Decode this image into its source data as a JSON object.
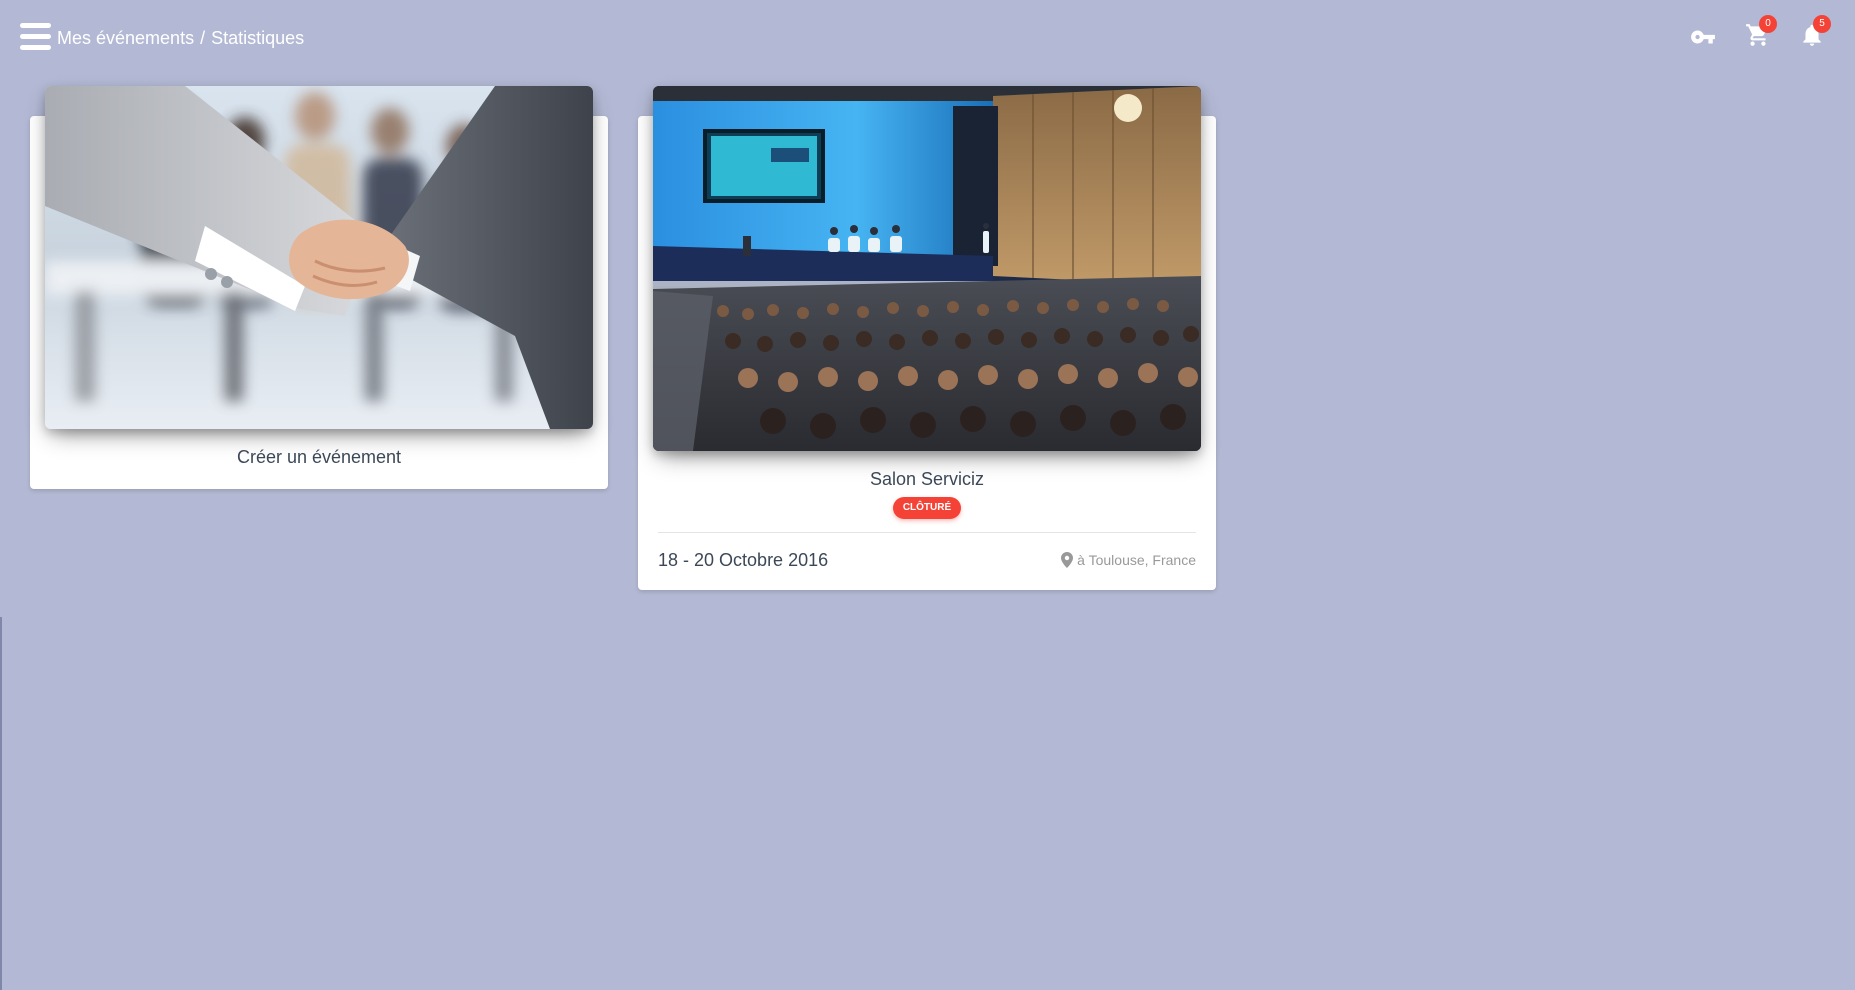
{
  "header": {
    "breadcrumb": [
      "Mes événements",
      "Statistiques"
    ],
    "breadcrumb_separator": "/",
    "icons": {
      "menu": "hamburger-menu-icon",
      "key": "key-icon",
      "cart": "shopping-cart-icon",
      "notifications": "bell-icon"
    },
    "cart_count": "0",
    "notification_count": "5"
  },
  "cards": {
    "create": {
      "title": "Créer un événement",
      "image": "handshake-business-photo"
    },
    "event": {
      "title": "Salon Serviciz",
      "status": "CLÔTURÉ",
      "date": "18 - 20 Octobre 2016",
      "location": "à Toulouse, France",
      "image": "conference-auditorium-photo"
    }
  },
  "colors": {
    "background": "#b3b9d4",
    "badge": "#f44336",
    "card": "#ffffff",
    "text": "#3c4858",
    "muted": "#999999"
  }
}
